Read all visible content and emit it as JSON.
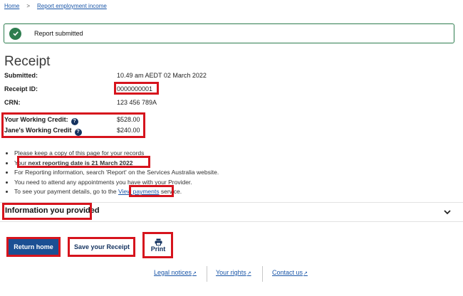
{
  "breadcrumb": {
    "home": "Home",
    "separator": ">",
    "current": "Report employment income"
  },
  "alert": {
    "message": "Report submitted",
    "icon": "check-circle-icon",
    "color": "#2e7d4f"
  },
  "receipt": {
    "title": "Receipt",
    "submitted_label": "Submitted:",
    "submitted_value": "10.49 am AEDT 02 March 2022",
    "receipt_id_label": "Receipt ID:",
    "receipt_id_value": "0000000001",
    "crn_label": "CRN:",
    "crn_value": "123 456 789A",
    "working_credit_label": "Your Working Credit:",
    "working_credit_value": "$528.00",
    "jane_credit_label": "Jane's Working Credit",
    "jane_credit_value": "$240.00",
    "help_glyph": "?"
  },
  "bullets": {
    "item1": "Please keep a copy of this page for your records",
    "item2_prefix": "Your ",
    "item2_bold": "next reporting date is 21 March 2022",
    "item3": "For Reporting information, search 'Report' on the Services Australia website.",
    "item4": "You need to attend any appointments you have with your Provider.",
    "item5_prefix": "To see your payment details, go to the ",
    "item5_link": "View payments",
    "item5_suffix": " service."
  },
  "accordion": {
    "title": "Information you provided"
  },
  "actions": {
    "return_home": "Return home",
    "save_receipt": "Save your Receipt",
    "print": "Print"
  },
  "footer": {
    "legal": "Legal notices",
    "rights": "Your rights",
    "contact": "Contact us"
  },
  "colors": {
    "primary": "#1b4f93",
    "link": "#1a56a8",
    "highlight": "#d6141d",
    "success": "#2e7d4f"
  }
}
